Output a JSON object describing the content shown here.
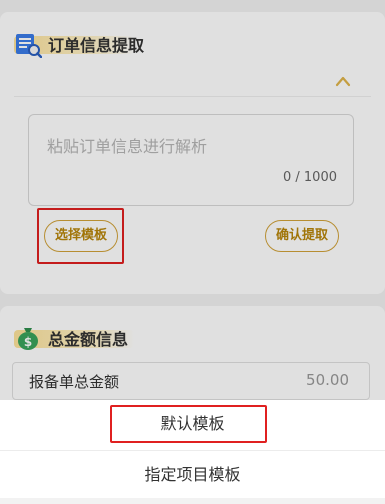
{
  "order_section": {
    "title": "订单信息提取",
    "icon": "invoice-search-icon",
    "textarea": {
      "placeholder": "粘贴订单信息进行解析",
      "counter": "0 / 1000"
    },
    "buttons": {
      "select_template": "选择模板",
      "confirm_extract": "确认提取"
    }
  },
  "amount_section": {
    "title": "总金额信息",
    "icon": "money-bag-icon",
    "row": {
      "label": "报备单总金额",
      "value": "50.00"
    }
  },
  "sheet": {
    "options": [
      {
        "label": "默认模板"
      },
      {
        "label": "指定项目模板"
      }
    ]
  },
  "colors": {
    "accent": "#d1a23a",
    "highlight_red": "#e02020"
  }
}
